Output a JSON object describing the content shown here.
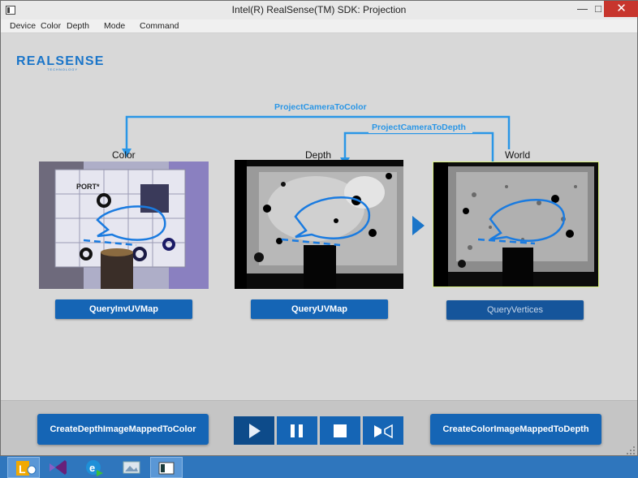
{
  "window": {
    "title": "Intel(R) RealSense(TM) SDK: Projection"
  },
  "titlebar": {
    "minimize_glyph": "—",
    "maximize_glyph": "□",
    "close_glyph": "✕"
  },
  "menu": {
    "items": [
      "Device",
      "Color",
      "Depth",
      "Mode",
      "Command"
    ]
  },
  "logo": {
    "text": "REALSENSE",
    "subtext": "TECHNOLOGY"
  },
  "views": {
    "color": {
      "label": "Color",
      "button": "QueryInvUVMap"
    },
    "depth": {
      "label": "Depth",
      "button": "QueryUVMap"
    },
    "world": {
      "label": "World",
      "button": "QueryVertices"
    }
  },
  "connectors": {
    "camera_to_color": "ProjectCameraToColor",
    "camera_to_depth": "ProjectCameraToDepth"
  },
  "board_text": "PORT*",
  "bottom": {
    "left_button": "CreateDepthImageMappedToColor",
    "right_button": "CreateColorImageMappedToDepth",
    "media_controls": [
      "play-icon",
      "pause-icon",
      "stop-icon",
      "mirror-icon"
    ]
  },
  "taskbar": {
    "items": [
      "lync-icon",
      "visual-studio-icon",
      "ie-update-icon",
      "photo-viewer-icon",
      "app-window-icon"
    ]
  },
  "colors": {
    "accent": "#1565b5",
    "connector": "#2a96e6",
    "close": "#c7352d",
    "taskbar": "#2f76bd"
  }
}
